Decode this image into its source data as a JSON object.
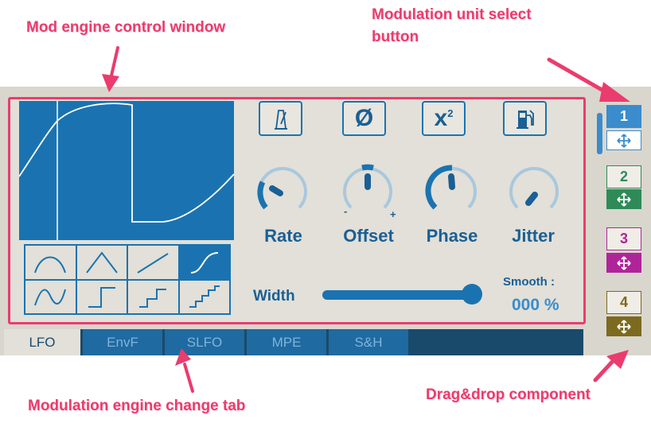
{
  "annotations": {
    "mod_window": "Mod engine control window",
    "unit_select_line1": "Modulation unit select",
    "unit_select_line2": "button",
    "engine_tab": "Modulation engine change tab",
    "drag_drop": "Drag&drop component"
  },
  "controls": {
    "top_buttons": [
      {
        "icon": "metronome-icon"
      },
      {
        "icon": "phase-invert-icon",
        "glyph": "Ø"
      },
      {
        "icon": "x-squared-icon",
        "glyph": "x",
        "sup": "2"
      },
      {
        "icon": "fuel-pump-icon"
      }
    ],
    "knobs": [
      {
        "label": "Rate"
      },
      {
        "label": "Offset",
        "minus": "-",
        "plus": "+"
      },
      {
        "label": "Phase"
      },
      {
        "label": "Jitter"
      }
    ],
    "width_label": "Width",
    "width_value": 0.95,
    "smooth_label": "Smooth :",
    "smooth_value": "000 %"
  },
  "shapes": [
    "sine-half",
    "triangle",
    "ramp",
    "s-curve",
    "sine",
    "step-1",
    "step-2",
    "step-3"
  ],
  "tabs": [
    "LFO",
    "EnvF",
    "SLFO",
    "MPE",
    "S&H"
  ],
  "units": [
    {
      "num": "1",
      "color": "#3a8ccc",
      "selected": true
    },
    {
      "num": "2",
      "color": "#2e8b57"
    },
    {
      "num": "3",
      "color": "#b0249a"
    },
    {
      "num": "4",
      "color": "#7c6a1e"
    }
  ],
  "colors": {
    "accent": "#ea3c6e",
    "primary": "#1a73b0",
    "panel": "#e2e0d8"
  }
}
